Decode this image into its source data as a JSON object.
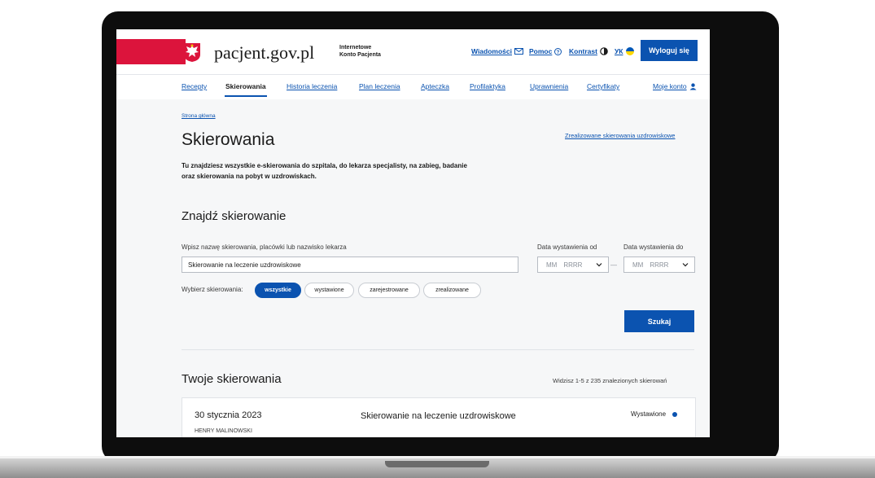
{
  "header": {
    "logo_text": "pacjent.gov.pl",
    "logo_sub_line1": "Internetowe",
    "logo_sub_line2": "Konto Pacjenta",
    "links": {
      "messages": "Wiadomości",
      "help": "Pomoc",
      "contrast": "Kontrast",
      "language": "УК"
    },
    "logout": "Wyloguj się"
  },
  "nav": {
    "items": [
      "Recepty",
      "Skierowania",
      "Historia leczenia",
      "Plan leczenia",
      "Apteczka",
      "Profilaktyka",
      "Uprawnienia",
      "Certyfikaty",
      "Moje konto"
    ],
    "active": "Skierowania"
  },
  "main": {
    "breadcrumb": "Strona główna",
    "title": "Skierowania",
    "spa_link": "Zrealizowane skierowania uzdrowiskowe",
    "intro_line1": "Tu znajdziesz wszystkie e-skierowania do szpitala, do lekarza specjalisty, na zabieg, badanie",
    "intro_line2": "oraz skierowania na pobyt w uzdrowiskach."
  },
  "search": {
    "heading": "Znajdź skierowanie",
    "query_label": "Wpisz nazwę skierowania, placówki lub nazwisko lekarza",
    "query_value": "Skierowanie na leczenie uzdrowiskowe",
    "date_from_label": "Data wystawienia od",
    "date_to_label": "Data wystawienia do",
    "date_mm": "MM",
    "date_yyyy": "RRRR",
    "date_dash": "—",
    "filter_label": "Wybierz skierowania:",
    "filters": [
      "wszystkie",
      "wystawione",
      "zarejestrowane",
      "zrealizowane"
    ],
    "active_filter": "wszystkie",
    "button": "Szukaj"
  },
  "results": {
    "heading": "Twoje skierowania",
    "count_text": "Widzisz 1-5 z 235 znalezionych skierowań",
    "items": [
      {
        "date": "30 stycznia 2023",
        "doctor": "HENRY MALINOWSKI",
        "title": "Skierowanie na leczenie uzdrowiskowe",
        "status": "Wystawione"
      }
    ]
  },
  "colors": {
    "accent": "#0b53b0",
    "flag_red": "#dc143c",
    "text": "#1b1b1b"
  },
  "icons": [
    "poland-eagle-icon",
    "envelope-icon",
    "help-circle-icon",
    "contrast-icon",
    "ukraine-flag-icon",
    "user-icon",
    "chevron-down-icon",
    "status-dot-icon"
  ]
}
